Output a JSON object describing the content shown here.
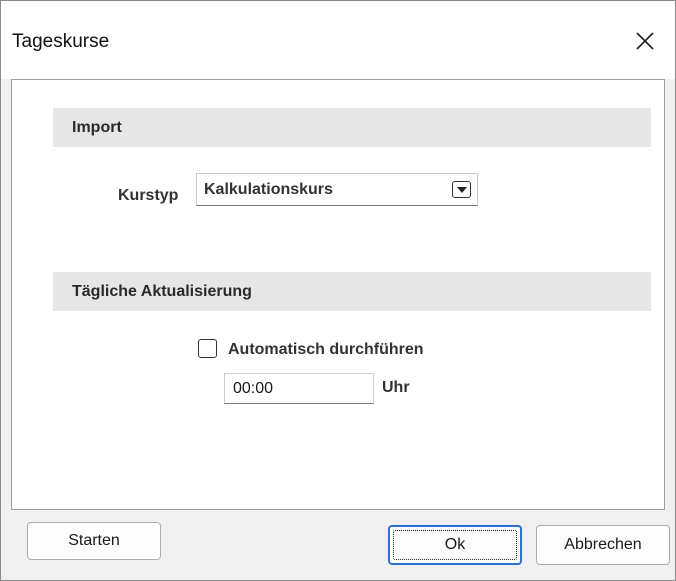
{
  "window": {
    "title": "Tageskurse"
  },
  "sections": {
    "import": {
      "title": "Import",
      "kurstyp_label": "Kurstyp",
      "kurstyp_value": "Kalkulationskurs"
    },
    "daily_update": {
      "title": "Tägliche Aktualisierung",
      "auto_label": "Automatisch durchführen",
      "auto_checked": false,
      "time_value": "00:00",
      "time_unit": "Uhr"
    }
  },
  "buttons": {
    "start": "Starten",
    "ok": "Ok",
    "cancel": "Abbrechen"
  }
}
